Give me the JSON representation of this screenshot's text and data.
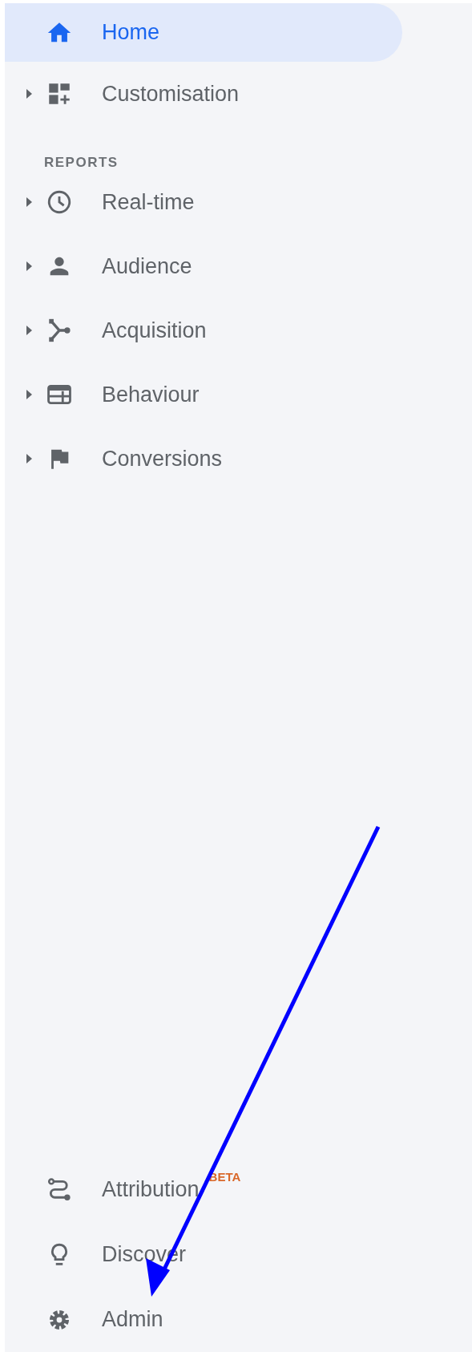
{
  "top_items": [
    {
      "label": "Home",
      "kind": "link",
      "selected": true
    },
    {
      "label": "Customisation",
      "kind": "group",
      "expanded": false,
      "selected": false
    }
  ],
  "reports_heading": "REPORTS",
  "report_items": [
    {
      "label": "Real-time",
      "kind": "group",
      "expanded": false,
      "selected": false
    },
    {
      "label": "Audience",
      "kind": "group",
      "expanded": false,
      "selected": false
    },
    {
      "label": "Acquisition",
      "kind": "group",
      "expanded": false,
      "selected": false
    },
    {
      "label": "Behaviour",
      "kind": "group",
      "expanded": false,
      "selected": false
    },
    {
      "label": "Conversions",
      "kind": "group",
      "expanded": false,
      "selected": false
    }
  ],
  "bottom_items": [
    {
      "label": "Attribution",
      "selected": false,
      "badge": "BETA"
    },
    {
      "label": "Discover",
      "selected": false
    },
    {
      "label": "Admin",
      "selected": false
    }
  ]
}
